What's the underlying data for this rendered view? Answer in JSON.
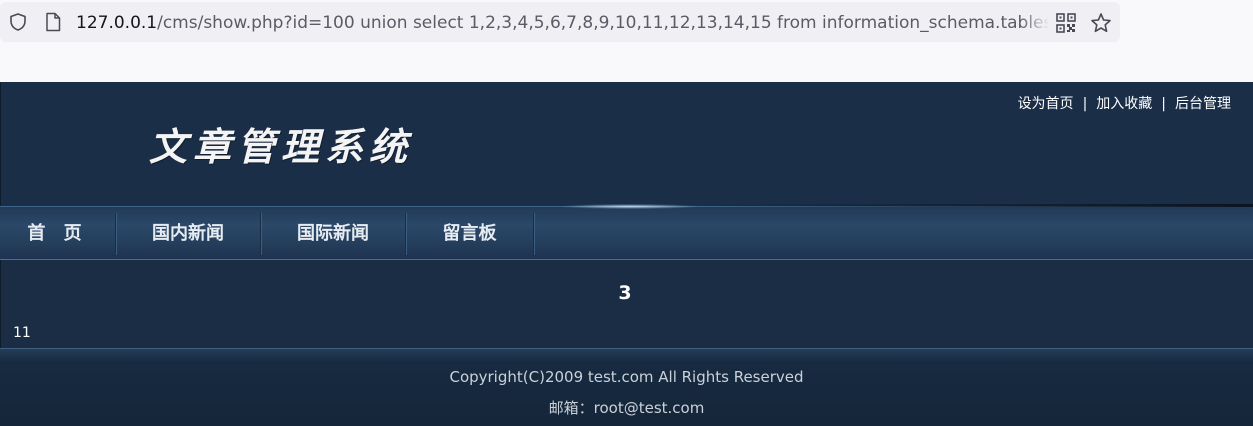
{
  "browser": {
    "url_host": "127.0.0.1",
    "url_path": "/cms/show.php?id=100 union select 1,2,3,4,5,6,7,8,9,10,11,12,13,14,15 from information_schema.tables where"
  },
  "header": {
    "logo_text": "文章管理系统",
    "top_links": [
      "设为首页",
      "加入收藏",
      "后台管理"
    ],
    "separator": "|"
  },
  "nav": {
    "items": [
      "首 页",
      "国内新闻",
      "国际新闻",
      "留言板"
    ]
  },
  "article": {
    "title": "3",
    "body": "11"
  },
  "footer": {
    "copyright": "Copyright(C)2009 test.com All Rights Reserved",
    "email": "邮箱：root@test.com"
  },
  "colors": {
    "page_background": "#1a2d45",
    "nav_background": "#2b4868",
    "footer_background": "#15263a",
    "text": "#ffffff"
  },
  "icons": [
    "shield-icon",
    "page-icon",
    "qr-code-icon",
    "bookmark-star-icon"
  ]
}
